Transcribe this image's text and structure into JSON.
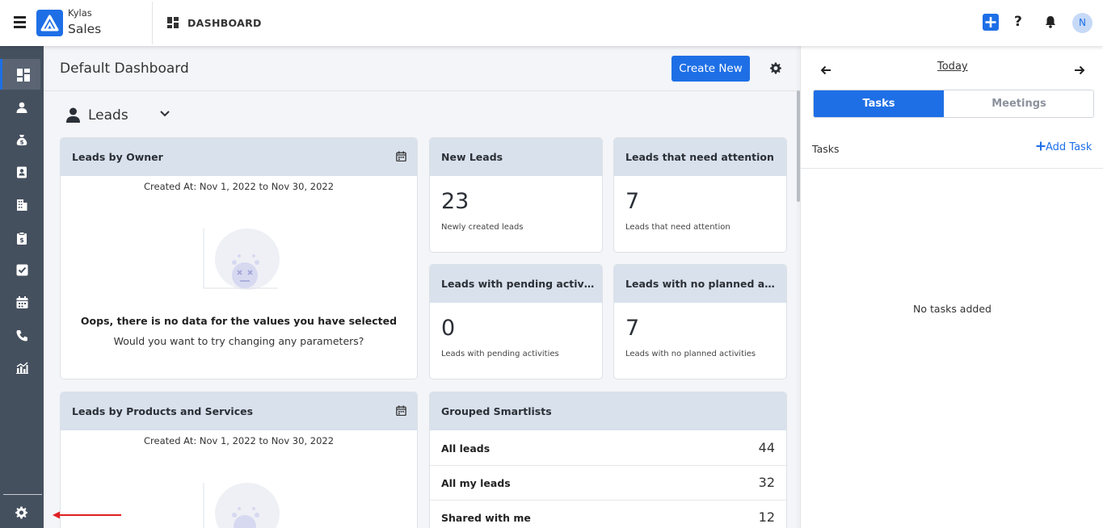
{
  "header": {
    "brand_top": "Kylas",
    "brand_bottom": "Sales",
    "section_title": "DASHBOARD",
    "help_label": "?",
    "avatar_initial": "N"
  },
  "colors": {
    "accent": "#1e6fe6",
    "sidebar_bg": "#45505f",
    "card_header_bg": "#d8e1ec"
  },
  "sidebar": {
    "items": [
      {
        "icon": "dashboard-icon",
        "active": true
      },
      {
        "icon": "user-icon"
      },
      {
        "icon": "money-bag-icon"
      },
      {
        "icon": "contact-card-icon"
      },
      {
        "icon": "building-icon"
      },
      {
        "icon": "clipboard-icon"
      },
      {
        "icon": "checkbox-icon"
      },
      {
        "icon": "calendar-icon"
      },
      {
        "icon": "phone-icon"
      },
      {
        "icon": "reports-icon"
      }
    ],
    "bottom_icon": "settings-gear-icon"
  },
  "main": {
    "page_title": "Default Dashboard",
    "create_button": "Create New",
    "entity_selector": "Leads",
    "cards": {
      "leads_by_owner": {
        "title": "Leads by Owner",
        "created_at": "Created At: Nov 1, 2022 to Nov 30, 2022",
        "empty_title": "Oops, there is no data for the values you have selected",
        "empty_subtitle": "Would you want to try changing any parameters?"
      },
      "leads_by_products": {
        "title": "Leads by Products and Services",
        "created_at": "Created At: Nov 1, 2022 to Nov 30, 2022"
      },
      "new_leads": {
        "title": "New Leads",
        "value": "23",
        "subtitle": "Newly created leads"
      },
      "need_attention": {
        "title": "Leads that need attention",
        "value": "7",
        "subtitle": "Leads that need attention"
      },
      "pending_activities": {
        "title": "Leads with pending activiti…",
        "value": "0",
        "subtitle": "Leads with pending activities"
      },
      "no_planned": {
        "title": "Leads with no planned acti…",
        "value": "7",
        "subtitle": "Leads with no planned activities"
      },
      "grouped_smartlists": {
        "title": "Grouped Smartlists",
        "rows": [
          {
            "name": "All leads",
            "count": "44"
          },
          {
            "name": "All my leads",
            "count": "32"
          },
          {
            "name": "Shared with me",
            "count": "12"
          }
        ]
      }
    }
  },
  "right_panel": {
    "date_label": "Today",
    "tabs": [
      {
        "label": "Tasks",
        "active": true
      },
      {
        "label": "Meetings",
        "active": false
      }
    ],
    "section_label": "Tasks",
    "add_task_label": "Add Task",
    "empty_message": "No tasks added"
  }
}
